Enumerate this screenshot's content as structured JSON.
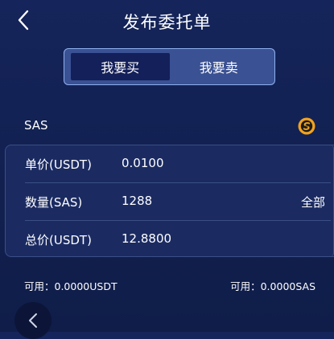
{
  "header": {
    "title": "发布委托单",
    "back_icon": "chevron-left-icon"
  },
  "toggle": {
    "options": [
      {
        "label": "我要买",
        "active": true
      },
      {
        "label": "我要卖",
        "active": false
      }
    ]
  },
  "token": {
    "name": "SAS",
    "icon": "sas-coin-icon",
    "icon_color": "#f2a21e"
  },
  "form": {
    "rows": [
      {
        "label": "单价(USDT)",
        "value": "0.0100"
      },
      {
        "label": "数量(SAS)",
        "value": "1288",
        "action": "全部"
      },
      {
        "label": "总价(USDT)",
        "value": "12.8800"
      }
    ]
  },
  "balances": {
    "left": "可用：0.0000USDT",
    "right": "可用：0.0000SAS"
  },
  "float_button_icon": "chevron-left-icon",
  "colors": {
    "background": "#122152",
    "card": "#1b2b62",
    "toggle_bg": "#3a5194",
    "toggle_active": "#14205a",
    "toggle_border": "#8fb0ee",
    "coin": "#f2a21e"
  }
}
